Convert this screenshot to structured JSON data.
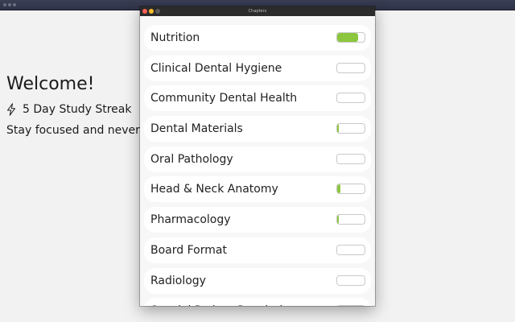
{
  "background_app": {
    "welcome": "Welcome!",
    "streak_text": "5 Day Study Streak",
    "streak_icon": "lightning-icon",
    "tagline": "Stay focused and never g"
  },
  "chapters_window": {
    "title": "Chapters",
    "accent_color": "#8cc63f",
    "chapters": [
      {
        "label": "Nutrition",
        "progress": 0.75
      },
      {
        "label": "Clinical Dental Hygiene",
        "progress": 0
      },
      {
        "label": "Community Dental Health",
        "progress": 0
      },
      {
        "label": "Dental Materials",
        "progress": 0.06
      },
      {
        "label": "Oral Pathology",
        "progress": 0
      },
      {
        "label": "Head & Neck Anatomy",
        "progress": 0.12
      },
      {
        "label": "Pharmacology",
        "progress": 0.06
      },
      {
        "label": "Board Format",
        "progress": 0
      },
      {
        "label": "Radiology",
        "progress": 0
      },
      {
        "label": "Special Patient Population",
        "progress": 0
      }
    ]
  }
}
